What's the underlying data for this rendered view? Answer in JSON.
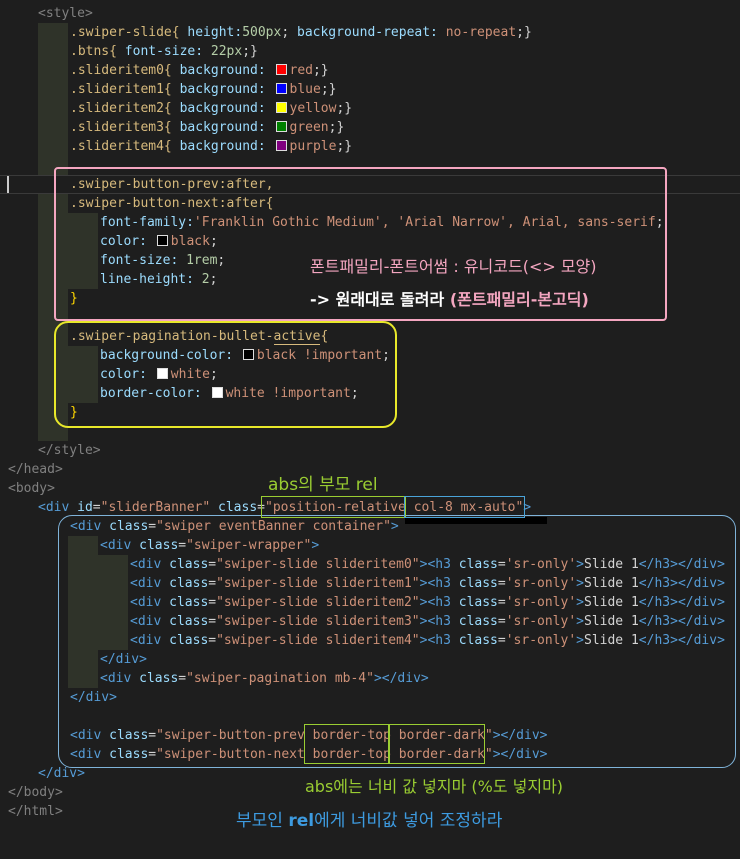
{
  "code": {
    "l1": {
      "tag": "<style>"
    },
    "l2": {
      "sel": ".swiper-slide{ ",
      "prop": "height:",
      "v1": "500px",
      "mid": "; ",
      "prop2": "background-repeat: ",
      "v2": "no-repeat",
      "end": ";}"
    },
    "l3": {
      "sel": ".btns{ ",
      "prop": "font-size: ",
      "v1": "22px",
      "end": ";}"
    },
    "l4": {
      "sel": ".slideritem0{ ",
      "prop": "background: ",
      "v1": "red",
      "end": ";}"
    },
    "l5": {
      "sel": ".slideritem1{ ",
      "prop": "background: ",
      "v1": "blue",
      "end": ";}"
    },
    "l6": {
      "sel": ".slideritem2{ ",
      "prop": "background: ",
      "v1": "yellow",
      "end": ";}"
    },
    "l7": {
      "sel": ".slideritem3{ ",
      "prop": "background: ",
      "v1": "green",
      "end": ";}"
    },
    "l8": {
      "sel": ".slideritem4{ ",
      "prop": "background: ",
      "v1": "purple",
      "end": ";}"
    },
    "l9": {
      "sel": ".swiper-button-prev:after,"
    },
    "l10": {
      "sel": ".swiper-button-next:after{"
    },
    "l11": {
      "prop": "font-family:",
      "v1": "'Franklin Gothic Medium', 'Arial Narrow', Arial, sans-serif",
      "end": ";"
    },
    "l12": {
      "prop": "color: ",
      "v1": "black",
      "end": ";"
    },
    "l13": {
      "prop": "font-size: ",
      "v1": "1rem",
      "end": ";"
    },
    "l14": {
      "prop": "line-height: ",
      "v1": "2",
      "end": ";"
    },
    "l15": {
      "end": "}"
    },
    "l16": {
      "sel1": ".swiper-pagination-bullet-",
      "sel2": "active",
      "sel3": "{"
    },
    "l17": {
      "prop": "background-color: ",
      "v1": "black !important",
      "end": ";"
    },
    "l18": {
      "prop": "color: ",
      "v1": "white",
      "end": ";"
    },
    "l19": {
      "prop": "border-color: ",
      "v1": "white !important",
      "end": ";"
    },
    "l20": {
      "end": "}"
    },
    "l21": {
      "tag": "</style>"
    },
    "l22": {
      "tag": "</head>"
    },
    "l23": {
      "tag": "<body>"
    },
    "l24": {
      "open": "<div ",
      "a1": "id",
      "eq1": "=",
      "v1": "\"sliderBanner\"",
      "a2": " class",
      "eq2": "=",
      "v2a": "\"position-relative",
      "v2b": " col-8 mx-auto\"",
      "close": ">"
    },
    "l25": {
      "open": "<div ",
      "a1": "class",
      "eq1": "=",
      "v1": "\"swiper eventBanner container\"",
      "close": ">"
    },
    "l26": {
      "open": "<div ",
      "a1": "class",
      "eq1": "=",
      "v1": "\"swiper-wrapper\"",
      "close": ">"
    },
    "slides": [
      {
        "v1": "\"swiper-slide slideritem0\""
      },
      {
        "v1": "\"swiper-slide slideritem1\""
      },
      {
        "v1": "\"swiper-slide slideritem2\""
      },
      {
        "v1": "\"swiper-slide slideritem3\""
      },
      {
        "v1": "\"swiper-slide slideritem4\""
      }
    ],
    "slide_common": {
      "open": "<div ",
      "a1": "class",
      "eq": "=",
      "gt": ">",
      "h3": "<h3 ",
      "a2": "class",
      "v2": "'sr-only'",
      "txt": "Slide 1",
      "closeh3": "</h3>",
      "closediv": "</div>"
    },
    "l32": {
      "tag": "</div>"
    },
    "l33": {
      "open": "<div ",
      "a1": "class",
      "eq1": "=",
      "v1": "\"swiper-pagination mb-4\"",
      "close": "></div>"
    },
    "l34": {
      "tag": "</div>"
    },
    "l36": {
      "open": "<div ",
      "a1": "class",
      "eq1": "=",
      "v1": "\"swiper-button-prev ",
      "v2": "border-top",
      "v3": " border-dark\"",
      "close": "></div>"
    },
    "l37": {
      "open": "<div ",
      "a1": "class",
      "eq1": "=",
      "v1": "\"swiper-button-next ",
      "v2": "border-top",
      "v3": " border-dark\"",
      "close": "></div>"
    },
    "l38": {
      "tag": "</div>"
    },
    "l39": {
      "tag": "</body>"
    },
    "l40": {
      "tag": "</html>"
    }
  },
  "annotations": {
    "font_note": "폰트패밀리-폰트어썸 : 유니코드(<> 모양)",
    "font_note2_a": "-> 원래대로 돌려라 ",
    "font_note2_b": "(폰트패밀리-본고딕)",
    "abs_parent": "abs의 부모 rel",
    "abs_width": "abs에는 너비 값 넣지마 (%도 넣지마)",
    "parent_rel_a": "부모인 ",
    "parent_rel_b": "rel",
    "parent_rel_c": "에게 너비값 넣어 조정하라"
  },
  "colors": {
    "red": "#ff0000",
    "blue": "#0000ff",
    "yellow": "#ffff00",
    "green": "#008000",
    "purple": "#800080",
    "black": "#000000",
    "white": "#ffffff",
    "pink_box": "#f4a6c0",
    "yellow_box": "#e8e82a",
    "green_box": "#9acd32",
    "blue_box": "#4aa3d8"
  }
}
